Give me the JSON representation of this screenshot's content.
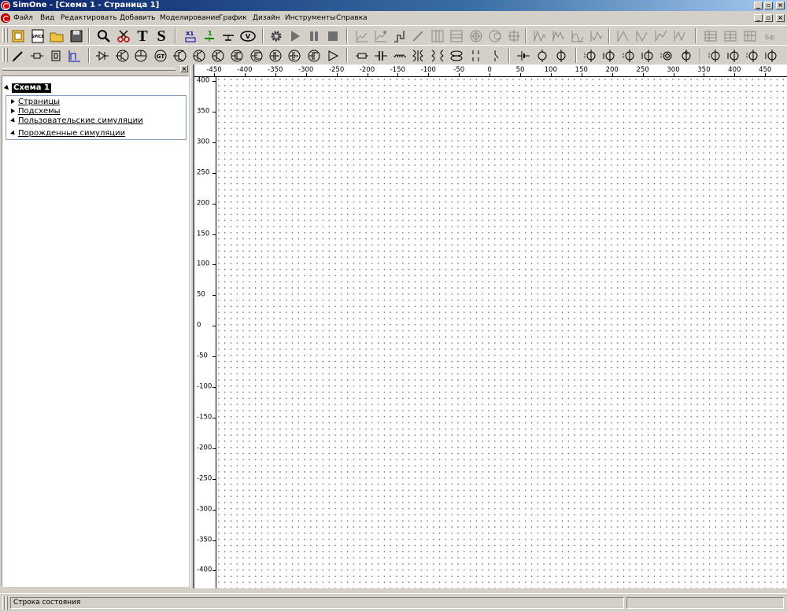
{
  "window": {
    "title": "SimOne - [Схема 1 - Страница 1]"
  },
  "menu": {
    "items": [
      "Файл",
      "Вид",
      "Редактировать",
      "Добавить",
      "Моделирование",
      "График",
      "Дизайн",
      "Инструменты",
      "Справка"
    ]
  },
  "toolbar1": {
    "spice_label": "SPICE",
    "text_tool": "T",
    "spice_tool": "S",
    "volt_label": "V"
  },
  "tree": {
    "root": "Схема 1",
    "children": [
      "Страницы",
      "Подсхемы",
      "Пользовательские симуляции",
      "Порожденные симуляции"
    ]
  },
  "ruler": {
    "x_labels": [
      "-450",
      "-400",
      "-350",
      "-300",
      "-250",
      "-200",
      "-150",
      "-100",
      "-50",
      "0",
      "50",
      "100",
      "150",
      "200",
      "250",
      "300",
      "350",
      "400",
      "450"
    ],
    "y_labels": [
      "400",
      "350",
      "300",
      "250",
      "200",
      "150",
      "100",
      "50",
      "0",
      "-50",
      "-100",
      "-150",
      "-200",
      "-250",
      "-300",
      "-350",
      "-400"
    ]
  },
  "status": {
    "text": "Строка состояния"
  },
  "colors": {
    "title_bar": "#0a246a",
    "accent": "#d00000"
  }
}
